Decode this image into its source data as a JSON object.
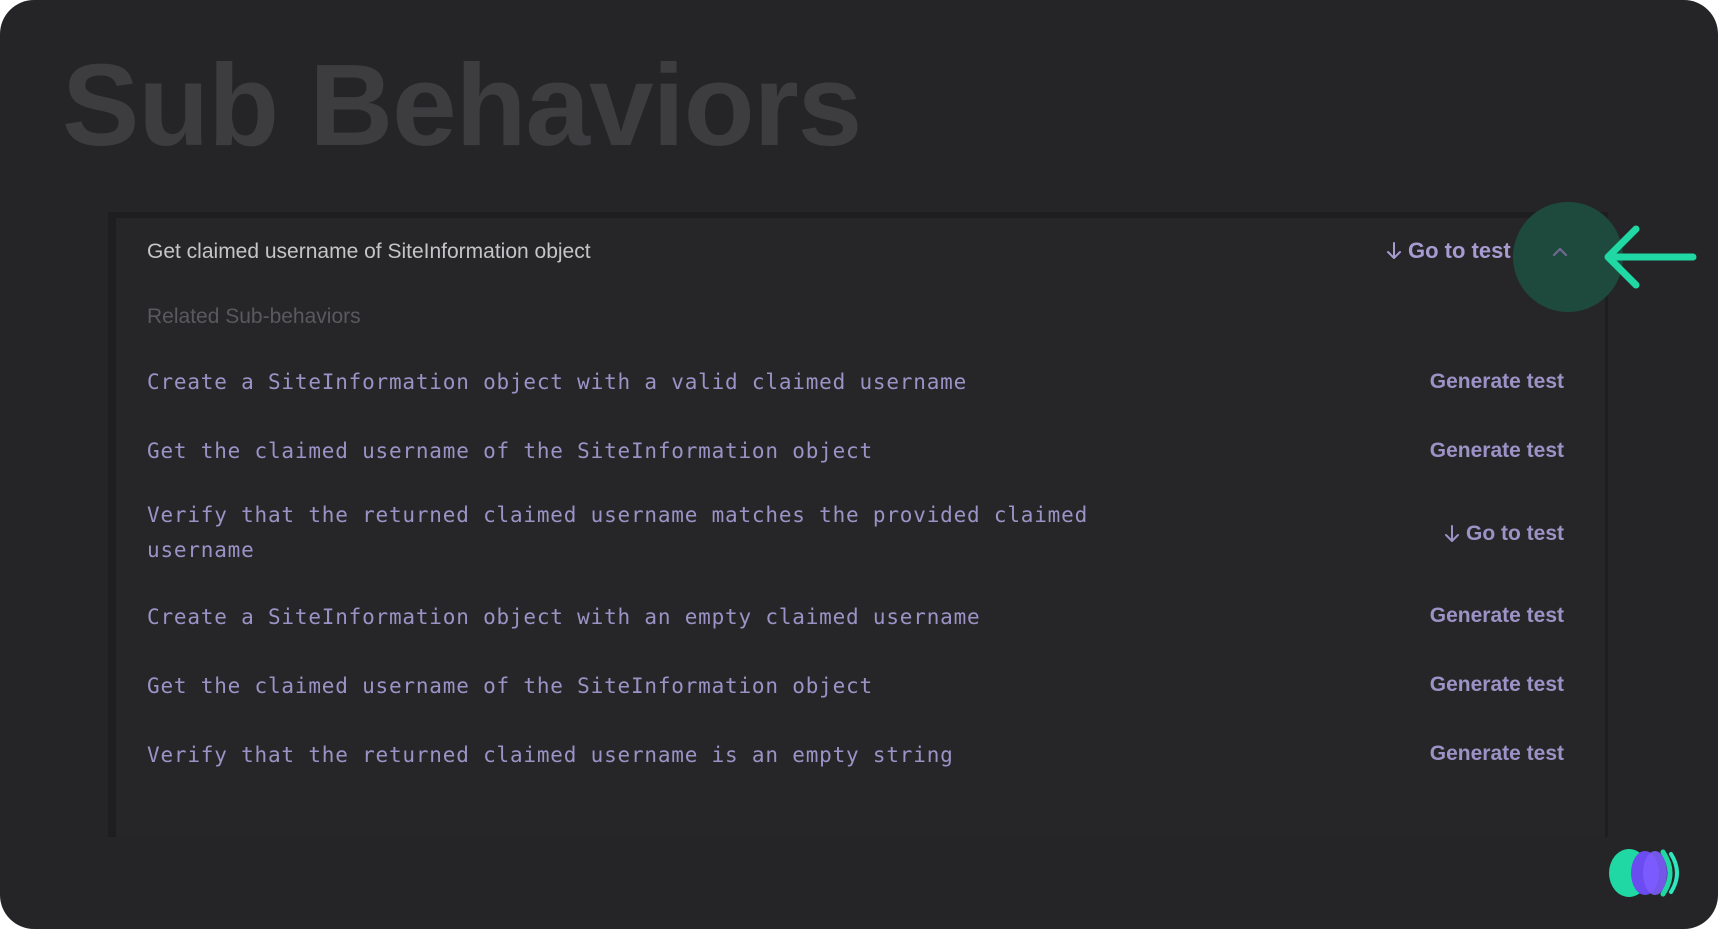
{
  "page": {
    "title": "Sub Behaviors"
  },
  "behavior": {
    "title": "Get claimed username of SiteInformation object",
    "go_to_test_label": "Go to test",
    "section_label": "Related Sub-behaviors"
  },
  "sub_behaviors": [
    {
      "text": "Create a SiteInformation object with a valid claimed username",
      "action": "Generate test"
    },
    {
      "text": "Get the claimed username of the SiteInformation object",
      "action": "Generate test"
    },
    {
      "text": "Verify that the returned claimed username matches the provided claimed username",
      "action": "Go to test"
    },
    {
      "text": "Create a SiteInformation object with an empty claimed username",
      "action": "Generate test"
    },
    {
      "text": "Get the claimed username of the SiteInformation object",
      "action": "Generate test"
    },
    {
      "text": "Verify that the returned claimed username is an empty string",
      "action": "Generate test"
    }
  ],
  "colors": {
    "background": "#252527",
    "accent_purple": "#a79bd2",
    "highlight_green": "#1fd8a4",
    "highlight_circle": "#1e4a3e"
  },
  "icons": {
    "go_to_test": "arrow-down-icon",
    "collapse": "chevron-up-icon",
    "callout": "arrow-left-icon",
    "logo": "brand-logo"
  }
}
